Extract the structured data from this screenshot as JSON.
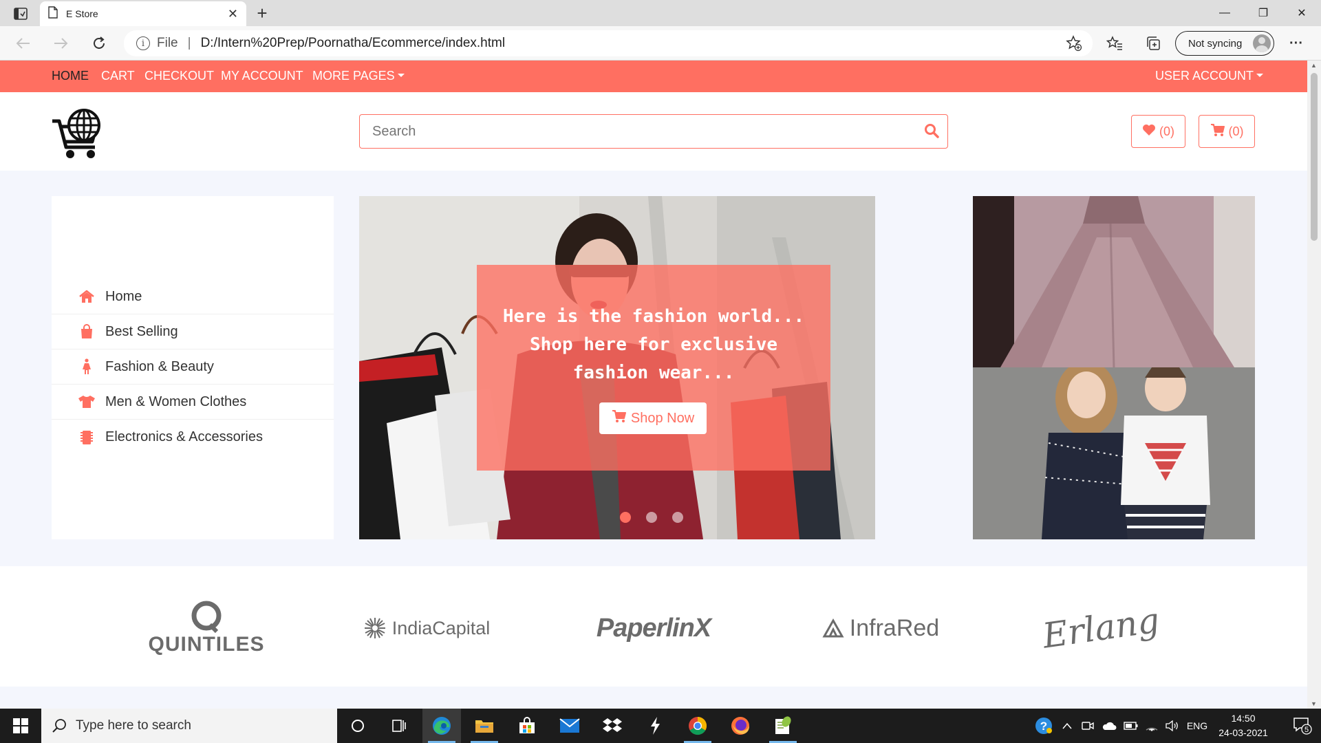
{
  "browser": {
    "tab_title": "E Store",
    "tab_close": "✕",
    "new_tab": "+",
    "url_scheme": "File",
    "url_separator": "|",
    "url": "D:/Intern%20Prep/Poornatha/Ecommerce/index.html",
    "sync_label": "Not syncing",
    "window_minimize": "—",
    "window_maximize": "❐",
    "window_close": "✕",
    "more_label": "···"
  },
  "nav": {
    "items": [
      {
        "label": "HOME",
        "active": true
      },
      {
        "label": "CART"
      },
      {
        "label": "CHECKOUT"
      },
      {
        "label": "MY ACCOUNT"
      },
      {
        "label": "MORE PAGES"
      }
    ],
    "user_account": "USER ACCOUNT"
  },
  "header": {
    "search_placeholder": "Search",
    "wishlist_count": "(0)",
    "cart_count": "(0)"
  },
  "sidebar": {
    "items": [
      {
        "label": "Home",
        "icon": "home-icon"
      },
      {
        "label": "Best Selling",
        "icon": "shopping-bag-icon"
      },
      {
        "label": "Fashion & Beauty",
        "icon": "female-icon"
      },
      {
        "label": "Men & Women Clothes",
        "icon": "tshirt-icon"
      },
      {
        "label": "Electronics & Accessories",
        "icon": "microchip-icon"
      }
    ]
  },
  "hero": {
    "line1": "Here is the fashion world...",
    "line2": "Shop here for exclusive",
    "line3": "fashion wear...",
    "button": "Shop Now",
    "slides": 3,
    "active_slide": 1
  },
  "brands": [
    "QUINTILES",
    "IndiaCapital",
    "PaperlinX",
    "InfraRed",
    "Erlang"
  ],
  "taskbar": {
    "search_placeholder": "Type here to search",
    "language": "ENG",
    "time": "14:50",
    "date": "24-03-2021",
    "notifications": "5"
  },
  "colors": {
    "accent": "#ff6f61",
    "page_bg": "#f4f6fd",
    "taskbar": "#1c1c1c"
  }
}
